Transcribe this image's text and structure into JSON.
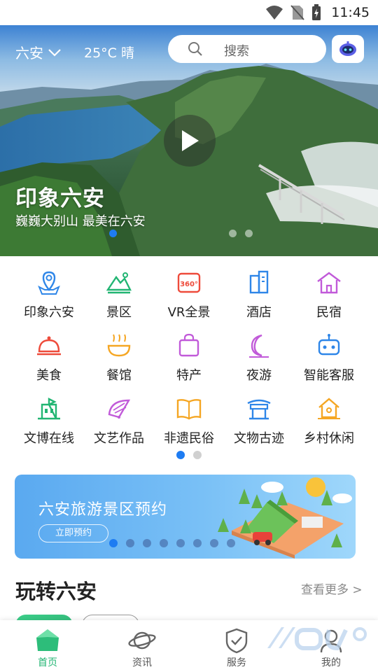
{
  "status_bar": {
    "time": "11:45"
  },
  "header": {
    "city": "六安",
    "weather": "25°C 晴",
    "search_placeholder": "搜索"
  },
  "hero": {
    "title": "印象六安",
    "subtitle": "巍巍大别山  最美在六安",
    "active_slide": 1,
    "slide_count": 3
  },
  "categories": [
    {
      "label": "印象六安",
      "icon": "map-icon",
      "color": "#2e86e8"
    },
    {
      "label": "景区",
      "icon": "mountain-icon",
      "color": "#22b573"
    },
    {
      "label": "VR全景",
      "icon": "vr-360-icon",
      "color": "#ee4b3b"
    },
    {
      "label": "酒店",
      "icon": "hotel-building-icon",
      "color": "#2e86e8"
    },
    {
      "label": "民宿",
      "icon": "house-icon",
      "color": "#c15ad9"
    },
    {
      "label": "美食",
      "icon": "food-cloche-icon",
      "color": "#ee4b3b"
    },
    {
      "label": "餐馆",
      "icon": "noodle-bowl-icon",
      "color": "#f5a623"
    },
    {
      "label": "特产",
      "icon": "shopping-bag-icon",
      "color": "#c15ad9"
    },
    {
      "label": "夜游",
      "icon": "moon-icon",
      "color": "#c15ad9"
    },
    {
      "label": "智能客服",
      "icon": "robot-icon",
      "color": "#2e86e8"
    },
    {
      "label": "文博在线",
      "icon": "museum-icon",
      "color": "#22b573"
    },
    {
      "label": "文艺作品",
      "icon": "fan-icon",
      "color": "#c15ad9"
    },
    {
      "label": "非遗民俗",
      "icon": "book-icon",
      "color": "#f5a623"
    },
    {
      "label": "文物古迹",
      "icon": "gate-icon",
      "color": "#2e86e8"
    },
    {
      "label": "乡村休闲",
      "icon": "cottage-icon",
      "color": "#f5a623"
    }
  ],
  "category_pager": {
    "active": 1,
    "count": 2
  },
  "banner": {
    "title": "六安旅游景区预约",
    "button": "立即预约",
    "active_slide": 1,
    "slide_count": 8
  },
  "section": {
    "title": "玩转六安",
    "more": "查看更多 >"
  },
  "bottom_nav": [
    {
      "label": "首页",
      "icon": "home-icon",
      "active": true
    },
    {
      "label": "资讯",
      "icon": "planet-icon",
      "active": false
    },
    {
      "label": "服务",
      "icon": "shield-check-icon",
      "active": false
    },
    {
      "label": "我的",
      "icon": "user-icon",
      "active": false
    }
  ],
  "colors": {
    "accent": "#1e7cf2",
    "green": "#22b573"
  }
}
